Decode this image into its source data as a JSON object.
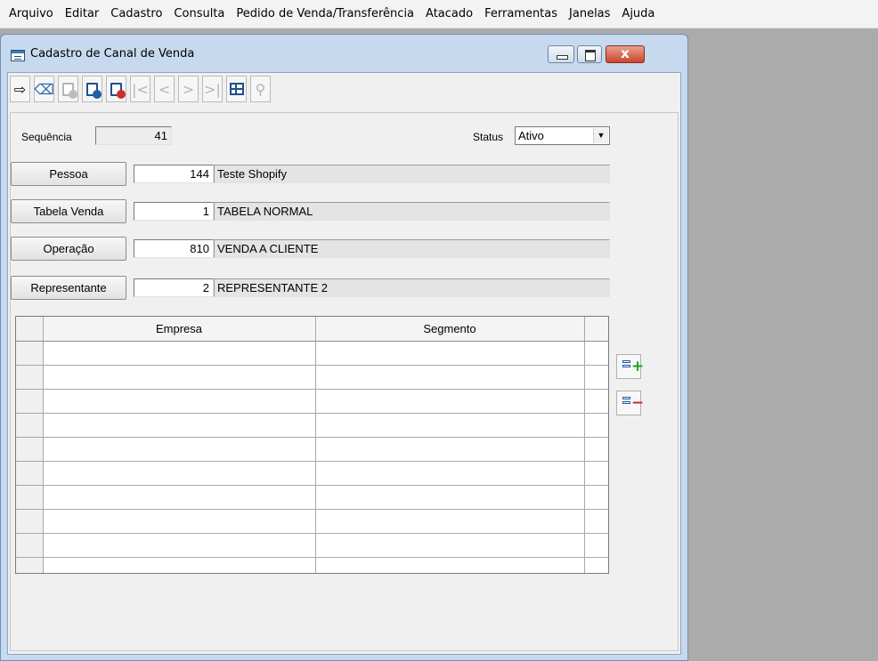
{
  "menu": [
    "Arquivo",
    "Editar",
    "Cadastro",
    "Consulta",
    "Pedido de Venda/Transferência",
    "Atacado",
    "Ferramentas",
    "Janelas",
    "Ajuda"
  ],
  "window": {
    "title": "Cadastro de Canal de Venda",
    "close_glyph": "x"
  },
  "toolbar": {
    "icons": [
      "exit-icon",
      "clear-icon",
      "new-record-icon",
      "save-record-icon",
      "delete-record-icon",
      "first-record-icon",
      "previous-record-icon",
      "next-record-icon",
      "last-record-icon",
      "grid-view-icon",
      "search-icon"
    ],
    "glyphs": {
      "first": "|<",
      "prev": "<",
      "next": ">",
      "last": ">|",
      "exit": "⇨",
      "clear": "⌫",
      "search": "⚲"
    }
  },
  "form": {
    "sequencia_label": "Sequência",
    "sequencia_value": "41",
    "status_label": "Status",
    "status_value": "Ativo",
    "pessoa_label": "Pessoa",
    "pessoa_code": "144",
    "pessoa_desc": "Teste Shopify",
    "tabela_label": "Tabela Venda",
    "tabela_code": "1",
    "tabela_desc": "TABELA NORMAL",
    "operacao_label": "Operação",
    "operacao_code": "810",
    "operacao_desc": "VENDA A CLIENTE",
    "representante_label": "Representante",
    "representante_code": "2",
    "representante_desc": "REPRESENTANTE 2"
  },
  "grid": {
    "columns": [
      "Empresa",
      "Segmento"
    ],
    "empty_rows": 10,
    "add_sign": "+",
    "remove_sign": "−"
  },
  "colors": {
    "window_frame": "#c7d9ee",
    "desktop": "#ababab",
    "icon_blue": "#1f5fa8",
    "delete_red": "#d12a2a",
    "add_green": "#1da31d"
  }
}
